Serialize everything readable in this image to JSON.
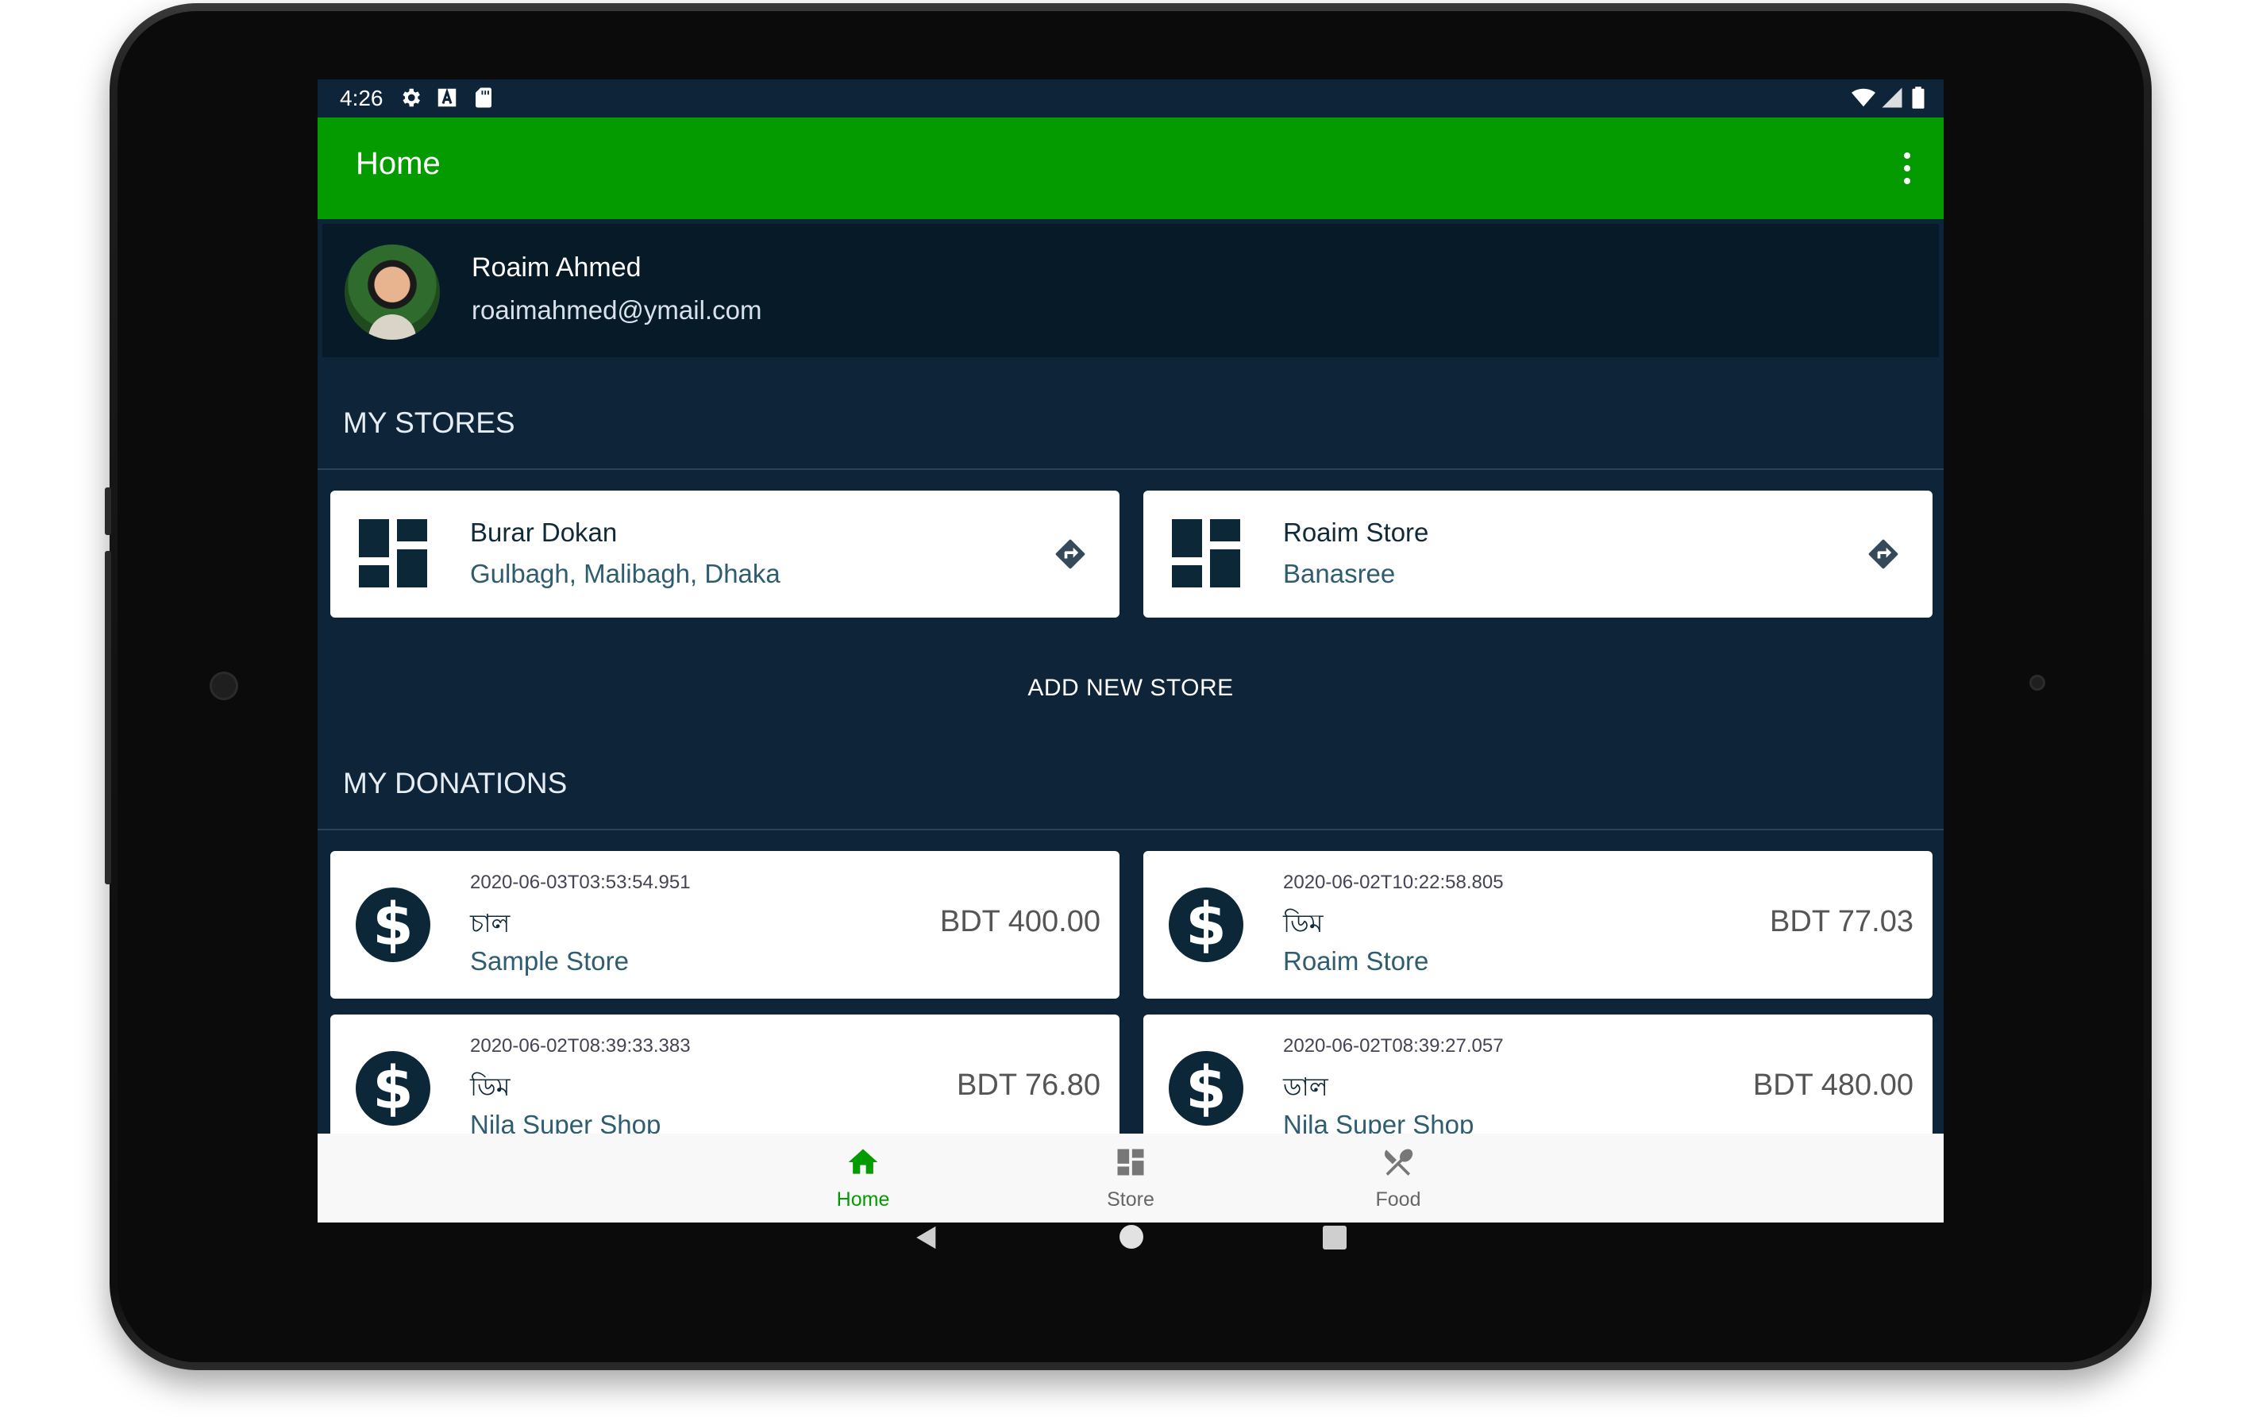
{
  "status_bar": {
    "time": "4:26",
    "left_icons": [
      "settings-icon",
      "a-icon",
      "sd-card-icon"
    ],
    "right_icons": [
      "wifi-icon",
      "signal-icon",
      "battery-icon"
    ]
  },
  "app_bar": {
    "title": "Home",
    "overflow_icon": "more-vert-icon",
    "color": "#039b00"
  },
  "profile": {
    "name": "Roaim Ahmed",
    "email": "roaimahmed@ymail.com"
  },
  "stores_section": {
    "title": "MY STORES",
    "items": [
      {
        "name": "Burar Dokan",
        "address": "Gulbagh, Malibagh, Dhaka",
        "icon": "dashboard-icon",
        "action_icon": "directions-icon"
      },
      {
        "name": "Roaim Store",
        "address": "Banasree",
        "icon": "dashboard-icon",
        "action_icon": "directions-icon"
      }
    ],
    "add_label": "ADD NEW STORE"
  },
  "donations_section": {
    "title": "MY DONATIONS",
    "items": [
      {
        "date": "2020-06-03T03:53:54.951",
        "item": "চাল",
        "store": "Sample Store",
        "amount": "BDT 400.00"
      },
      {
        "date": "2020-06-02T10:22:58.805",
        "item": "ডিম",
        "store": "Roaim Store",
        "amount": "BDT 77.03"
      },
      {
        "date": "2020-06-02T08:39:33.383",
        "item": "ডিম",
        "store": "Nila Super Shop",
        "amount": "BDT 76.80"
      },
      {
        "date": "2020-06-02T08:39:27.057",
        "item": "ডাল",
        "store": "Nila Super Shop",
        "amount": "BDT 480.00"
      }
    ]
  },
  "bottom_nav": {
    "tabs": [
      {
        "label": "Home",
        "icon": "home-icon",
        "active": true
      },
      {
        "label": "Store",
        "icon": "dashboard-icon",
        "active": false
      },
      {
        "label": "Food",
        "icon": "restaurant-icon",
        "active": false
      }
    ]
  },
  "system_nav": [
    "back-icon",
    "home-circle-icon",
    "recents-icon"
  ],
  "colors": {
    "primary": "#039b00",
    "background": "#0e2438",
    "card": "#ffffff",
    "icon_dark": "#0c2737"
  }
}
